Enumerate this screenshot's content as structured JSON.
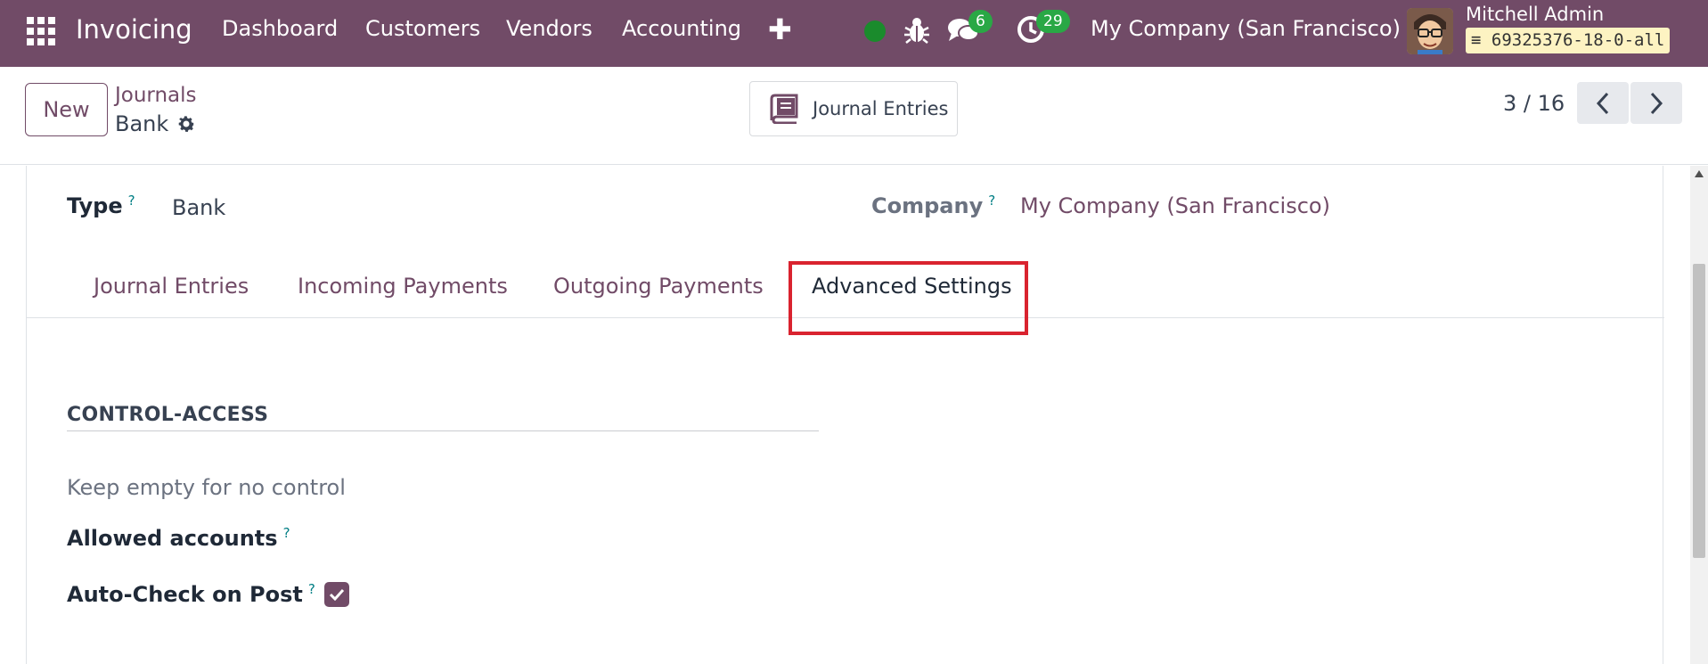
{
  "navbar": {
    "app_name": "Invoicing",
    "menu": [
      "Dashboard",
      "Customers",
      "Vendors",
      "Accounting"
    ],
    "messages_count": "6",
    "activities_count": "29",
    "company": "My Company (San Francisco)",
    "user_name": "Mitchell Admin",
    "database": "69325376-18-0-all",
    "status_color": "#1a8b2c",
    "brand_color": "#714b67"
  },
  "control_panel": {
    "new_label": "New",
    "breadcrumb": "Journals",
    "record_title": "Bank",
    "smart_button_label": "Journal Entries",
    "pager": "3 / 16"
  },
  "form": {
    "type_label": "Type",
    "type_value": "Bank",
    "company_label": "Company",
    "company_value": "My Company (San Francisco)",
    "help_mark": "?",
    "tabs": [
      {
        "label": "Journal Entries",
        "active": false
      },
      {
        "label": "Incoming Payments",
        "active": false
      },
      {
        "label": "Outgoing Payments",
        "active": false
      },
      {
        "label": "Advanced Settings",
        "active": true
      }
    ],
    "section_title": "CONTROL-ACCESS",
    "hint": "Keep empty for no control",
    "allowed_accounts_label": "Allowed accounts",
    "auto_check_label": "Auto-Check on Post",
    "auto_check_value": true,
    "highlight_color": "#d9232f"
  }
}
